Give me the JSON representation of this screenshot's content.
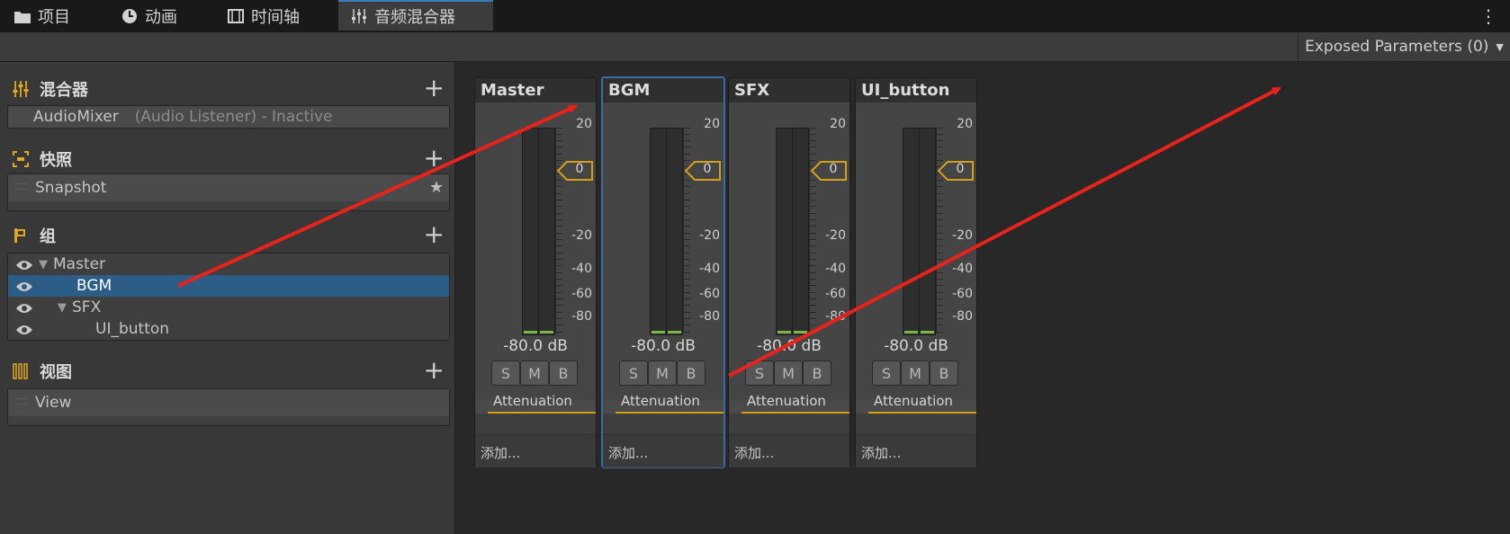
{
  "tabs": [
    {
      "label": "项目",
      "icon": "folder-icon"
    },
    {
      "label": "动画",
      "icon": "clock-icon"
    },
    {
      "label": "时间轴",
      "icon": "film-icon"
    },
    {
      "label": "音频混合器",
      "icon": "mixer-icon",
      "active": true
    }
  ],
  "toolbar": {
    "exposed_params": "Exposed Parameters (0)"
  },
  "left": {
    "mixers": {
      "title": "混合器",
      "item_name": "AudioMixer",
      "item_status": "(Audio Listener) - Inactive"
    },
    "snapshots": {
      "title": "快照",
      "item": "Snapshot"
    },
    "groups": {
      "title": "组",
      "items": [
        "Master",
        "BGM",
        "SFX",
        "UI_button"
      ],
      "selected": "BGM"
    },
    "views": {
      "title": "视图",
      "item": "View"
    }
  },
  "strips": [
    {
      "name": "Master",
      "db": "-80.0 dB",
      "attenuation": "Attenuation",
      "add": "添加..."
    },
    {
      "name": "BGM",
      "db": "-80.0 dB",
      "attenuation": "Attenuation",
      "add": "添加...",
      "selected": true
    },
    {
      "name": "SFX",
      "db": "-80.0 dB",
      "attenuation": "Attenuation",
      "add": "添加..."
    },
    {
      "name": "UI_button",
      "db": "-80.0 dB",
      "attenuation": "Attenuation",
      "add": "添加..."
    }
  ],
  "strip_buttons": [
    "S",
    "M",
    "B"
  ],
  "meter": {
    "scale_labels": [
      "20",
      "-20",
      "-40",
      "-60",
      "-80"
    ],
    "fader_value": "0"
  },
  "colors": {
    "accent_selected": "#2c5d87",
    "fader_marker": "#d4a017",
    "level": "#7ab844",
    "arrow": "#e8231b"
  }
}
